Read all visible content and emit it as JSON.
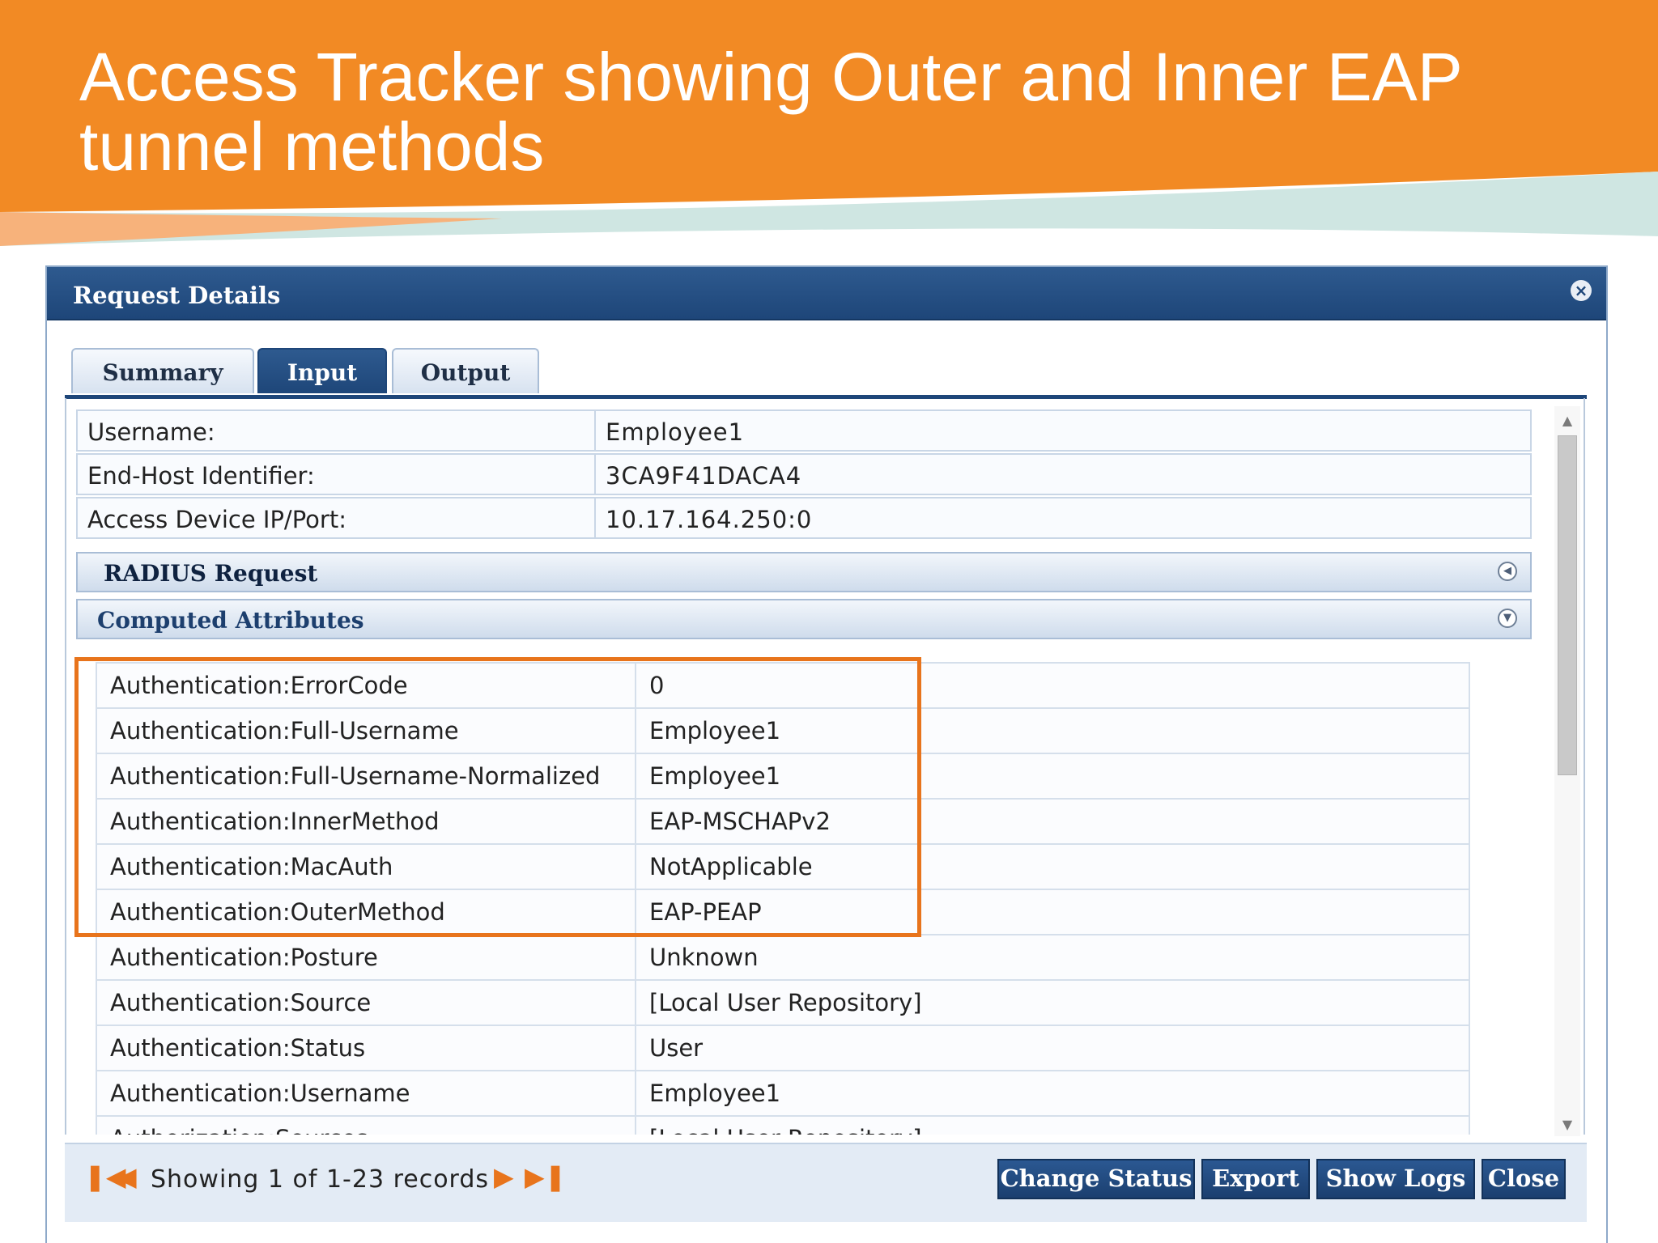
{
  "slide": {
    "title_line1": "Access Tracker showing Outer and Inner EAP",
    "title_line2": "tunnel methods"
  },
  "colors": {
    "banner_orange": "#f28a24",
    "highlight_orange": "#e8741c",
    "dialog_blue": "#1e4679"
  },
  "dialog": {
    "title": "Request Details",
    "close_icon": "close-icon",
    "tabs": [
      {
        "label": "Summary",
        "active": false
      },
      {
        "label": "Input",
        "active": true
      },
      {
        "label": "Output",
        "active": false
      }
    ],
    "fields": [
      {
        "label": "Username:",
        "value": "Employee1"
      },
      {
        "label": "End-Host Identifier:",
        "value": "3CA9F41DACA4"
      },
      {
        "label": "Access Device IP/Port:",
        "value": "10.17.164.250:0"
      }
    ],
    "sections": [
      {
        "label": "RADIUS Request",
        "state": "collapsed",
        "icon": "expand-left-icon"
      },
      {
        "label": "Computed Attributes",
        "state": "expanded",
        "icon": "collapse-down-icon"
      }
    ],
    "attributes": [
      {
        "name": "Authentication:ErrorCode",
        "value": "0"
      },
      {
        "name": "Authentication:Full-Username",
        "value": "Employee1"
      },
      {
        "name": "Authentication:Full-Username-Normalized",
        "value": "Employee1"
      },
      {
        "name": "Authentication:InnerMethod",
        "value": "EAP-MSCHAPv2"
      },
      {
        "name": "Authentication:MacAuth",
        "value": "NotApplicable"
      },
      {
        "name": "Authentication:OuterMethod",
        "value": "EAP-PEAP"
      },
      {
        "name": "Authentication:Posture",
        "value": "Unknown"
      },
      {
        "name": "Authentication:Source",
        "value": "[Local User Repository]"
      },
      {
        "name": "Authentication:Status",
        "value": "User"
      },
      {
        "name": "Authentication:Username",
        "value": "Employee1"
      },
      {
        "name": "Authorization:Sources",
        "value": "[Local User Repository]"
      }
    ],
    "highlighted_rows": 6,
    "footer": {
      "pager_text": "Showing 1 of 1-23 records",
      "first_icon": "first-page-icon",
      "prev_icon": "previous-page-icon",
      "next_icon": "next-page-icon",
      "last_icon": "last-page-icon",
      "buttons": [
        "Change Status",
        "Export",
        "Show Logs",
        "Close"
      ]
    }
  }
}
